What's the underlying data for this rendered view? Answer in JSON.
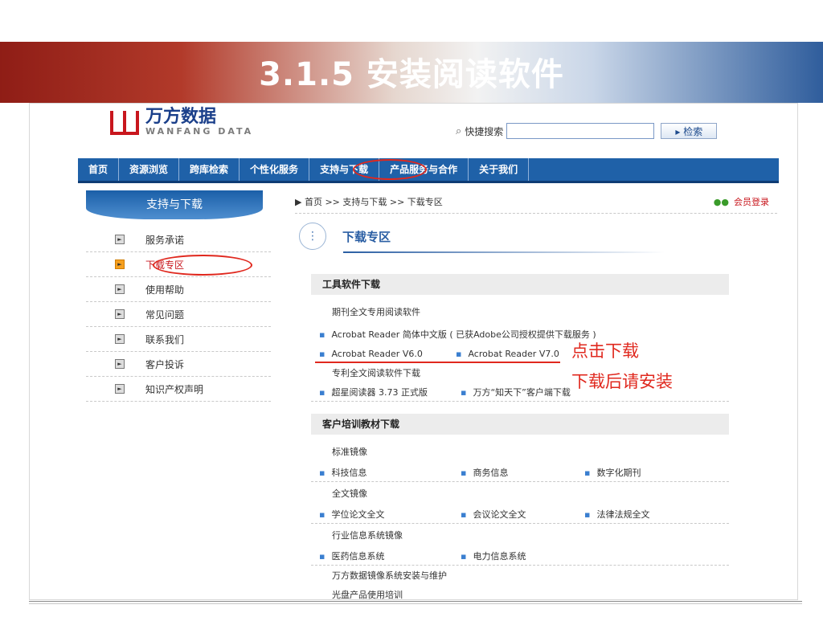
{
  "slide": {
    "title": "3.1.5 安装阅读软件"
  },
  "site": {
    "logo_cn": "万方数据",
    "logo_en": "WANFANG DATA",
    "quick_search_label": "快捷搜索",
    "quick_search_value": "",
    "search_button": "▸ 检索",
    "nav": [
      "首页",
      "资源浏览",
      "跨库检索",
      "个性化服务",
      "支持与下载",
      "产品服务与合作",
      "关于我们"
    ],
    "breadcrumb": "▶ 首页 >> 支持与下载 >> 下载专区",
    "login": "会员登录",
    "sidebar": {
      "title": "支持与下载",
      "items": [
        "服务承诺",
        "下载专区",
        "使用帮助",
        "常见问题",
        "联系我们",
        "客户投诉",
        "知识产权声明"
      ]
    },
    "section_title": "下载专区",
    "tools": {
      "header": "工具软件下载",
      "journal_label": "期刊全文专用阅读软件",
      "acrobat_cn": "Acrobat Reader 简体中文版 ( 已获Adobe公司授权提供下载服务 )",
      "acrobat_v6": "Acrobat Reader V6.0",
      "acrobat_v7": "Acrobat Reader V7.0",
      "patent_label": "专利全文阅读软件下载",
      "superstar": "超星阅读器 3.73 正式版",
      "zhitianxia": "万方“知天下”客户端下载"
    },
    "training": {
      "header": "客户培训教材下载",
      "std_label": "标准镜像",
      "std_items": [
        "科技信息",
        "商务信息",
        "数字化期刊"
      ],
      "fulltext_label": "全文镜像",
      "fulltext_items": [
        "学位论文全文",
        "会议论文全文",
        "法律法规全文"
      ],
      "industry_label": "行业信息系统镜像",
      "industry_items": [
        "医药信息系统",
        "电力信息系统"
      ],
      "install_label": "万方数据镜像系统安装与维护",
      "cut_label": "光盘产品使用培训"
    }
  },
  "annotations": {
    "click": "点击下载",
    "install": "下载后请安装"
  },
  "colors": {
    "nav_blue": "#1f61a8",
    "annot_red": "#e0281e",
    "band_red": "#8f1d16",
    "band_blue": "#2f5d9c"
  }
}
